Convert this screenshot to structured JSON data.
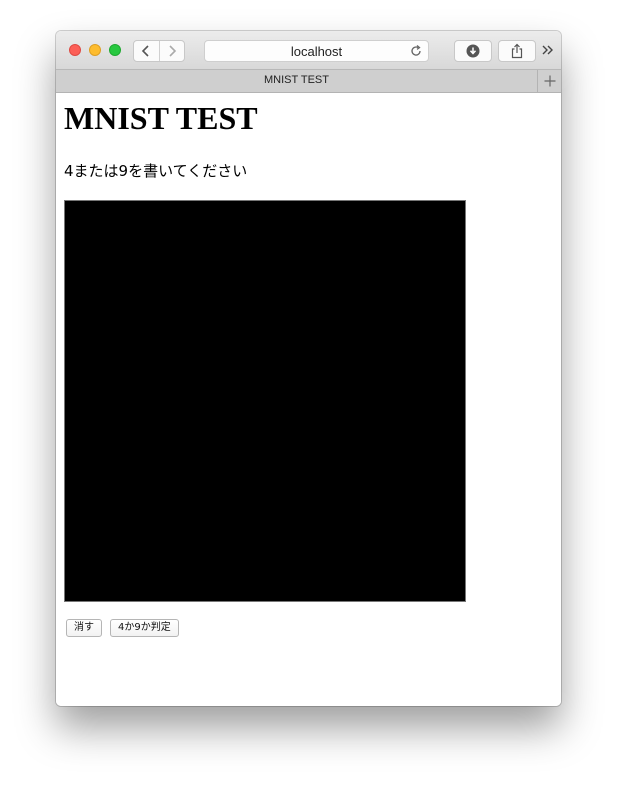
{
  "browser": {
    "url": "localhost",
    "tab_title": "MNIST TEST",
    "icons": [
      "back-icon",
      "forward-icon",
      "reload-icon",
      "download-icon",
      "share-icon",
      "more-chevron-icon",
      "plus-icon"
    ]
  },
  "page": {
    "title": "MNIST TEST",
    "instruction": "4または9を書いてください",
    "canvas_color": "#000000",
    "buttons": {
      "clear": "消す",
      "judge": "4か9か判定"
    }
  },
  "colors": {
    "close": "#fc5f57",
    "minimize": "#fdbc2e",
    "maximize": "#28c840"
  }
}
